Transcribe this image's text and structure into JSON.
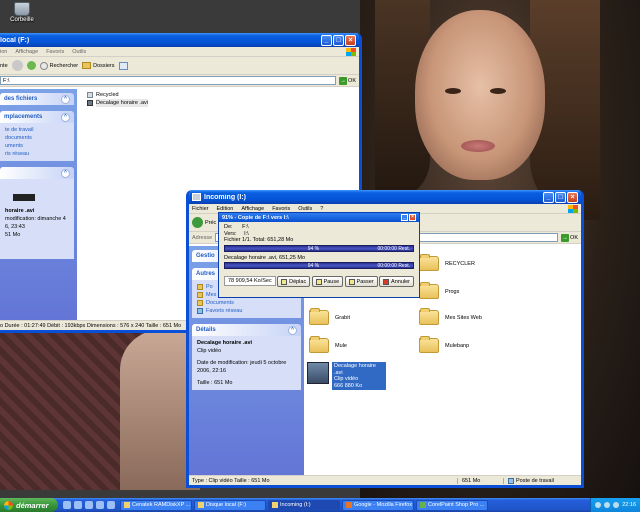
{
  "desktop": {
    "icon_label": "Corbeille"
  },
  "back_window": {
    "title": "local (F:)",
    "menu": [
      "ion",
      "Affichage",
      "Favoris",
      "Outils"
    ],
    "toolbar": {
      "back": "nte",
      "search": "Rechercher",
      "folders": "Dossiers"
    },
    "address": "F:\\",
    "go": "OK",
    "tasks": {
      "files_header": "des fichiers",
      "places_header": "mplacements",
      "places_items": [
        "te de travail",
        "documents",
        "uments",
        "ris réseau"
      ],
      "details_name": "horaire .avi",
      "details_date": "modification: dimanche 4",
      "details_date2": "6, 23:43",
      "details_size": "51 Mo"
    },
    "files": [
      {
        "name": "Recycled"
      },
      {
        "name": "Decalage horaire .avi"
      }
    ],
    "status": "o Durée : 01:27:49 Débit : 193kbps Dimensions : 576 x 240 Taille : 651 Mo"
  },
  "main_window": {
    "title": "Incoming (I:)",
    "menu": [
      "Fichier",
      "Edition",
      "Affichage",
      "Favoris",
      "Outils",
      "?"
    ],
    "toolbar": {
      "back": "Préc"
    },
    "address_label": "Adresse",
    "go": "OK",
    "tasks": {
      "management_header": "Gestio",
      "other_header": "Autres",
      "other_items": [
        "Po",
        "Mes documents",
        "Documents",
        "Favoris réseau"
      ],
      "details_header": "Détails",
      "details_name": "Decalage horaire .avi",
      "details_type": "Clip vidéo",
      "details_date": "Date de modification: jeudi 5 octobre 2006, 22:16",
      "details_size": "Taille : 651 Mo"
    },
    "folders": [
      "RECYCLER",
      "Progs",
      "Grabit",
      "Mes Sites Web",
      "Mule",
      "Mulebanp"
    ],
    "selected_file": {
      "name": "Decalage horaire .avi",
      "type": "Clip vidéo",
      "size": "666 880 Ko"
    },
    "status": {
      "type": "Type : Clip vidéo Taille : 651 Mo",
      "size": "651 Mo",
      "location": "Poste de travail"
    }
  },
  "copy_dialog": {
    "title": "91% - Copie de F:\\ vers I:\\",
    "from_label": "De:",
    "from": "F:\\",
    "to_label": "Vers:",
    "to": "I:\\",
    "files": "Fichier 1/1. Total: 651,28 Mo",
    "total_pct": "94 %",
    "total_rest": "00:00:00 Rest.",
    "file_line": "Decalage horaire .avi, 651,25 Mo",
    "file_pct": "94 %",
    "file_rest": "00:00:00 Rest.",
    "speed": "78 909,54 Ko/Sec",
    "progress": 0.94,
    "buttons": {
      "move": "Déplac",
      "pause": "Pause",
      "skip": "Passer",
      "cancel": "Annuler"
    }
  },
  "taskbar": {
    "start": "démarrer",
    "tasks": [
      "Cenatek RAMDiskXP ...",
      "Disque local (F:)",
      "Incoming (I:)",
      "Google - Mozilla Firefox",
      "CorelPaint Shop Pro ..."
    ],
    "clock": "22:16"
  }
}
